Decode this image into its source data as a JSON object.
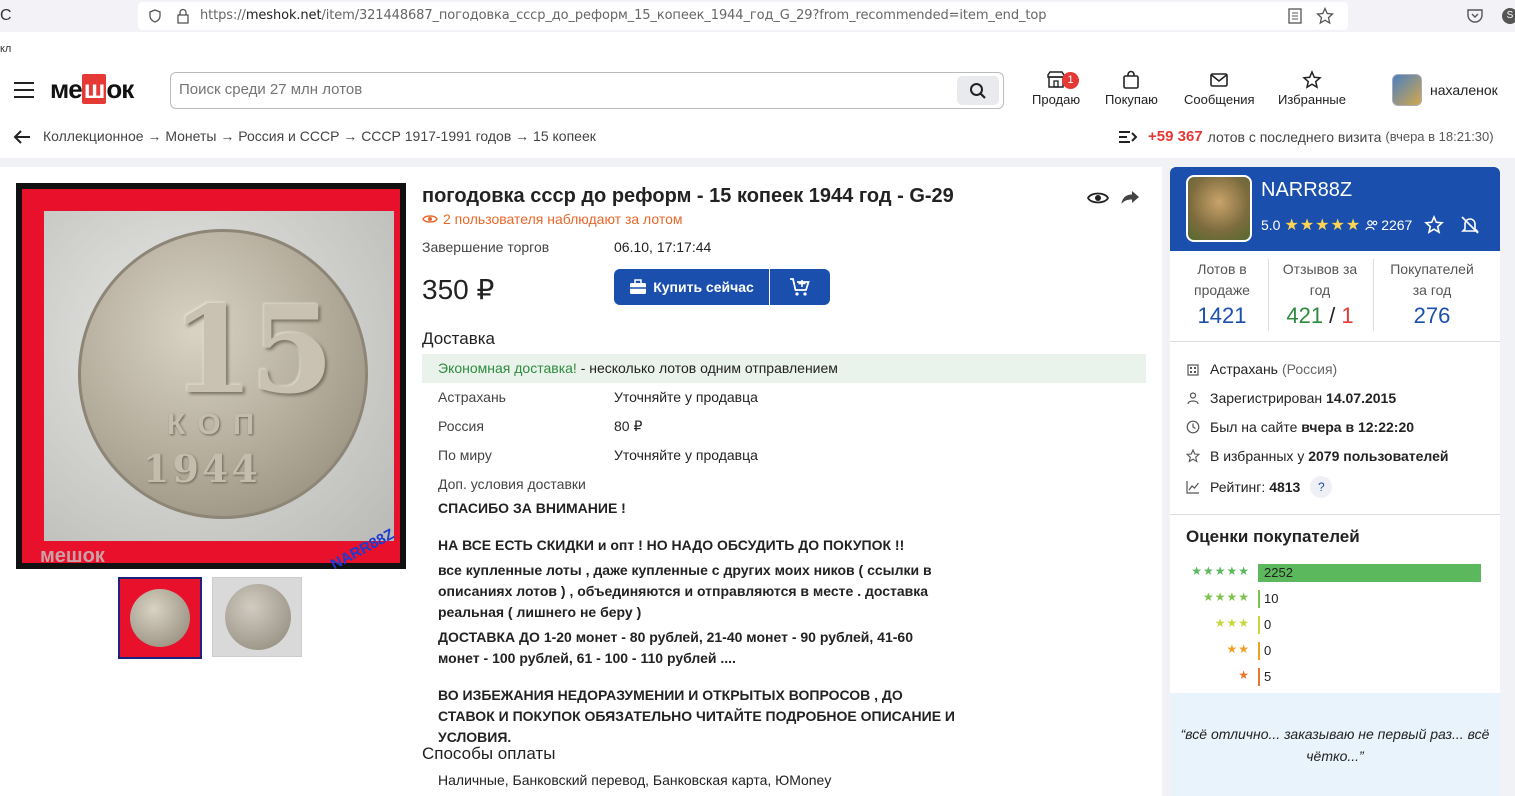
{
  "browser": {
    "url_prefix": "https://",
    "url_host": "meshok.net",
    "url_path": "/item/321448687_погодовка_ссср_до_реформ_15_копеек_1944_год_G_29?from_recommended=item_end_top",
    "tab_fragment": "кл"
  },
  "header": {
    "logo": "meшok",
    "search_placeholder": "Поиск среди 27 млн лотов",
    "nav": {
      "sell": "Продаю",
      "sell_badge": "1",
      "buy": "Покупаю",
      "messages": "Сообщения",
      "favorites": "Избранные"
    },
    "username": "нахаленок"
  },
  "breadcrumbs": "Коллекционное → Монеты → Россия и СССР → СССР 1917-1991 годов → 15 копеек",
  "new_lots": {
    "count": "+59 367",
    "label": "лотов с последнего визита",
    "since": "(вчера в 18:21:30)"
  },
  "lot": {
    "title": "погодовка ссср до реформ - 15 копеек 1944 год - G-29",
    "watchers": "2 пользователя наблюдают за лотом",
    "end_label": "Завершение торгов",
    "end_value": "06.10, 17:17:44",
    "price": "350 ₽",
    "buy_now": "Купить сейчас",
    "photo": {
      "coin_value": "15",
      "coin_kop": "КОП",
      "coin_year": "1944",
      "watermark_site": "мешок",
      "watermark_seller": "NARR88Z"
    }
  },
  "delivery": {
    "heading": "Доставка",
    "economy_label": "Экономная доставка!",
    "economy_text": " - несколько лотов одним отправлением",
    "rows": [
      {
        "place": "Астрахань",
        "value": "Уточняйте у продавца"
      },
      {
        "place": "Россия",
        "value": "80 ₽"
      },
      {
        "place": "По миру",
        "value": "Уточняйте у продавца"
      }
    ],
    "extra_label": "Доп. условия доставки",
    "desc": [
      "СПАСИБО ЗА ВНИМАНИЕ !",
      "НА ВСЕ ЕСТЬ СКИДКИ и опт ! НО НАДО ОБСУДИТЬ ДО ПОКУПОК !!",
      "все купленные лоты , даже купленные с других моих ников ( ссылки в описаниях лотов ) , объединяются и отправляются в месте . доставка реальная ( лишнего не беру )",
      "ДОСТАВКА ДО 1-20 монет - 80 рублей, 21-40 монет - 90 рублей, 41-60 монет - 100 рублей, 61 - 100 - 110 рублей ....",
      "ВО ИЗБЕЖАНИЯ НЕДОРАЗУМЕНИИ И ОТКРЫТЫХ ВОПРОСОВ , ДО СТАВОК И ПОКУПОК ОБЯЗАТЕЛЬНО ЧИТАЙТЕ ПОДРОБНОЕ ОПИСАНИЕ И УСЛОВИЯ."
    ]
  },
  "payment": {
    "heading": "Способы оплаты",
    "methods": "Наличные, Банковский перевод, Банковская карта, ЮMoney"
  },
  "seller": {
    "name": "NARR88Z",
    "rating": "5.0",
    "stars": "★★★★★",
    "followers": "2267",
    "stats": [
      {
        "label": "Лотов в продаже",
        "value": "1421"
      },
      {
        "label": "Отзывов за год",
        "value_pos": "421",
        "sep": " / ",
        "value_neg": "1"
      },
      {
        "label": "Покупателей за год",
        "value": "276"
      }
    ],
    "city": "Астрахань",
    "country": "(Россия)",
    "registered_label": "Зарегистрирован",
    "registered_date": "14.07.2015",
    "online_label": "Был на сайте",
    "online_value": "вчера в 12:22:20",
    "fav_label": "В избранных у",
    "fav_value": "2079 пользователей",
    "rating_label": "Рейтинг:",
    "rating_value": "4813",
    "rating_help": "?"
  },
  "ratings": {
    "heading": "Оценки покупателей",
    "rows": [
      {
        "stars": "★★★★★",
        "count": "2252",
        "color": "#5cb85c"
      },
      {
        "stars": "★★★★",
        "count": "10",
        "color": "#7dc24b"
      },
      {
        "stars": "★★★",
        "count": "0",
        "color": "#c8d63a"
      },
      {
        "stars": "★★",
        "count": "0",
        "color": "#f0a020"
      },
      {
        "stars": "★",
        "count": "5",
        "color": "#e8772e"
      }
    ],
    "quote": "“всё отлично... заказываю не первый раз... всё чётко...”"
  }
}
